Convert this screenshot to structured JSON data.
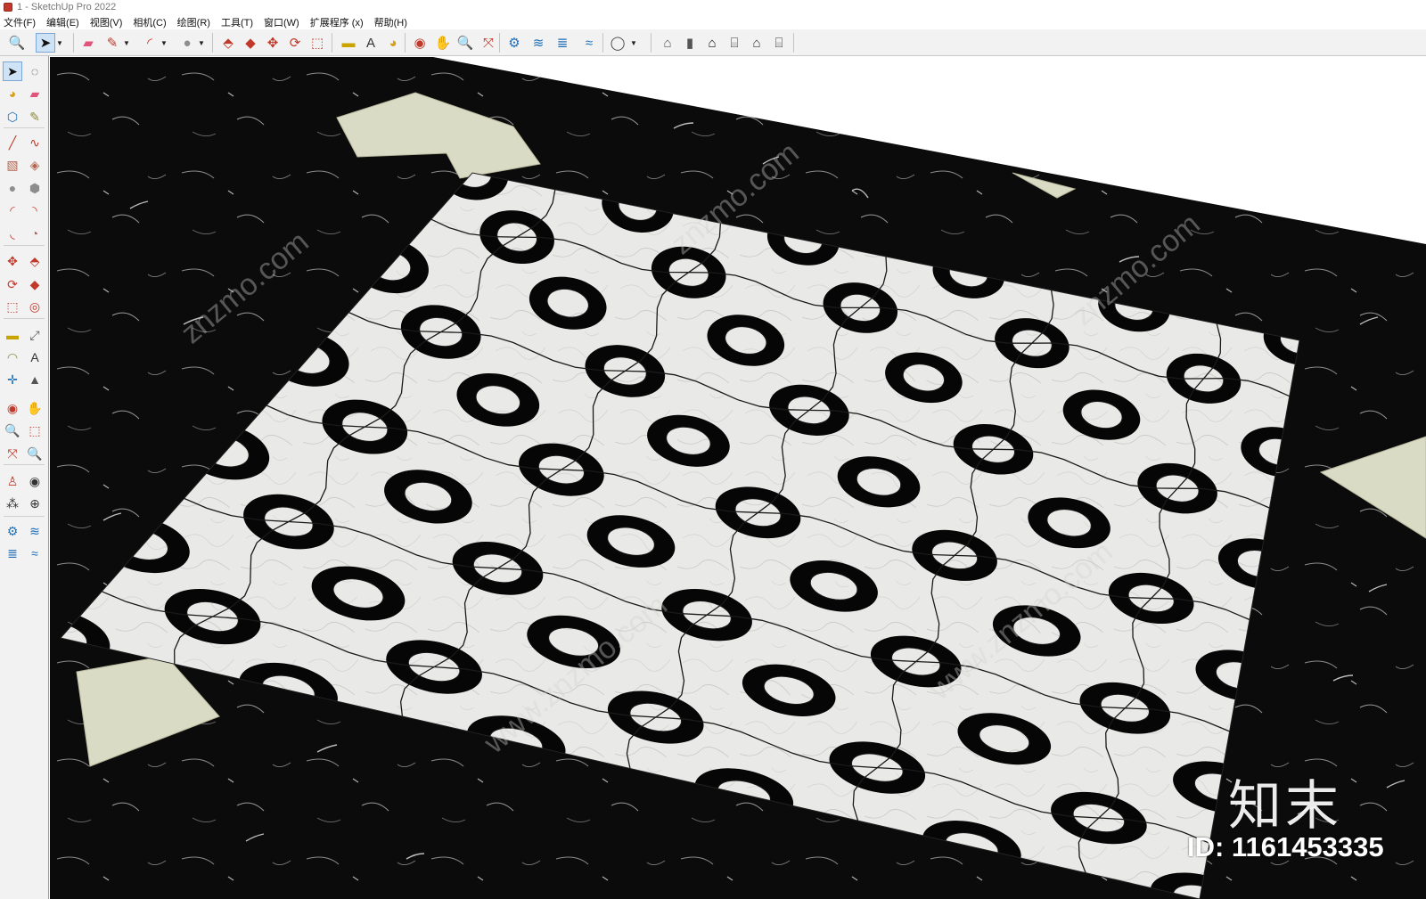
{
  "window": {
    "title": "1 - SketchUp Pro 2022"
  },
  "menu": {
    "items": [
      "文件(F)",
      "编辑(E)",
      "视图(V)",
      "相机(C)",
      "绘图(R)",
      "工具(T)",
      "窗口(W)",
      "扩展程序 (x)",
      "帮助(H)"
    ]
  },
  "toolbar": {
    "tools": [
      {
        "icon": "zoom-icon",
        "glyph": "🔍",
        "color": "#2b2b2b"
      },
      {
        "icon": "select-arrow-icon",
        "glyph": "➤",
        "color": "#111111",
        "active": true
      },
      {
        "icon": "eraser-icon",
        "glyph": "▰",
        "color": "#e2557b"
      },
      {
        "icon": "pencil-line-icon",
        "glyph": "✎",
        "color": "#c0392b"
      },
      {
        "icon": "arc-icon",
        "glyph": "◜",
        "color": "#c0392b"
      },
      {
        "icon": "circle-shape-icon",
        "glyph": "●",
        "color": "#8d8d8d"
      },
      {
        "icon": "push-pull-icon",
        "glyph": "⬘",
        "color": "#c0392b"
      },
      {
        "icon": "follow-me-icon",
        "glyph": "◆",
        "color": "#c0392b"
      },
      {
        "icon": "move-icon",
        "glyph": "✥",
        "color": "#c0392b"
      },
      {
        "icon": "rotate-icon",
        "glyph": "⟳",
        "color": "#c0392b"
      },
      {
        "icon": "scale-icon",
        "glyph": "⬚",
        "color": "#c0392b"
      },
      {
        "icon": "tape-measure-icon",
        "glyph": "▬",
        "color": "#c9a400"
      },
      {
        "icon": "text-label-icon",
        "glyph": "A",
        "color": "#333333"
      },
      {
        "icon": "paint-bucket-icon",
        "glyph": "◕",
        "color": "#d4a017"
      },
      {
        "icon": "orbit-icon",
        "glyph": "◉",
        "color": "#c0392b"
      },
      {
        "icon": "pan-hand-icon",
        "glyph": "✋",
        "color": "#d4a017"
      },
      {
        "icon": "zoom-tool-icon",
        "glyph": "🔍",
        "color": "#1f4e8a"
      },
      {
        "icon": "zoom-extents-icon",
        "glyph": "⤧",
        "color": "#c0392b"
      },
      {
        "icon": "3d-warehouse-icon",
        "glyph": "⚙",
        "color": "#1f6fb8"
      },
      {
        "icon": "extension-warehouse-icon",
        "glyph": "≋",
        "color": "#1f6fb8"
      },
      {
        "icon": "layout-send-icon",
        "glyph": "≣",
        "color": "#1f6fb8"
      },
      {
        "icon": "extension-manager-icon",
        "glyph": "≈",
        "color": "#1f6fb8"
      },
      {
        "icon": "user-account-icon",
        "glyph": "◯",
        "color": "#444444"
      },
      {
        "icon": "iso-view-icon",
        "glyph": "⌂",
        "color": "#555555"
      },
      {
        "icon": "top-view-icon",
        "glyph": "▮",
        "color": "#555555"
      },
      {
        "icon": "front-view-icon",
        "glyph": "⌂",
        "color": "#111111"
      },
      {
        "icon": "right-view-icon",
        "glyph": "⌸",
        "color": "#333333"
      },
      {
        "icon": "back-view-icon",
        "glyph": "⌂",
        "color": "#333333"
      },
      {
        "icon": "left-view-icon",
        "glyph": "⌸",
        "color": "#333333"
      }
    ]
  },
  "palette": {
    "tools": [
      {
        "icon": "select-arrow-icon",
        "glyph": "➤",
        "color": "#111111",
        "active": true
      },
      {
        "icon": "lasso-select-icon",
        "glyph": "◌",
        "color": "#333333"
      },
      {
        "icon": "paint-bucket-icon",
        "glyph": "◕",
        "color": "#d4a017"
      },
      {
        "icon": "eraser-icon",
        "glyph": "▰",
        "color": "#e2557b"
      },
      {
        "icon": "make-component-icon",
        "glyph": "⬡",
        "color": "#1f6fb8"
      },
      {
        "icon": "tag-tool-icon",
        "glyph": "✎",
        "color": "#8a8a3a"
      },
      {
        "icon": "line-icon",
        "glyph": "╱",
        "color": "#c0392b"
      },
      {
        "icon": "freehand-icon",
        "glyph": "∿",
        "color": "#c0392b"
      },
      {
        "icon": "rectangle-icon",
        "glyph": "▧",
        "color": "#b5654f"
      },
      {
        "icon": "rotated-rectangle-icon",
        "glyph": "◈",
        "color": "#b5654f"
      },
      {
        "icon": "circle-icon",
        "glyph": "●",
        "color": "#8d8d8d"
      },
      {
        "icon": "polygon-icon",
        "glyph": "⬢",
        "color": "#8d8d8d"
      },
      {
        "icon": "arc-2pt-icon",
        "glyph": "◜",
        "color": "#c0392b"
      },
      {
        "icon": "arc-3pt-icon",
        "glyph": "◝",
        "color": "#c0392b"
      },
      {
        "icon": "arc-center-icon",
        "glyph": "◟",
        "color": "#c0392b"
      },
      {
        "icon": "pie-icon",
        "glyph": "◔",
        "color": "#b5654f"
      },
      {
        "icon": "move-icon",
        "glyph": "✥",
        "color": "#c0392b"
      },
      {
        "icon": "push-pull-icon",
        "glyph": "⬘",
        "color": "#c0392b"
      },
      {
        "icon": "rotate-icon",
        "glyph": "⟳",
        "color": "#c0392b"
      },
      {
        "icon": "follow-me-icon",
        "glyph": "◆",
        "color": "#c0392b"
      },
      {
        "icon": "scale-icon",
        "glyph": "⬚",
        "color": "#c0392b"
      },
      {
        "icon": "offset-icon",
        "glyph": "◎",
        "color": "#c0392b"
      },
      {
        "icon": "tape-measure-icon",
        "glyph": "▬",
        "color": "#c9a400"
      },
      {
        "icon": "dimension-icon",
        "glyph": "⤢",
        "color": "#555555"
      },
      {
        "icon": "protractor-icon",
        "glyph": "◠",
        "color": "#8a8a3a"
      },
      {
        "icon": "text-label-icon",
        "glyph": "A",
        "color": "#333333"
      },
      {
        "icon": "axes-icon",
        "glyph": "✛",
        "color": "#1f6fb8"
      },
      {
        "icon": "3d-text-icon",
        "glyph": "▲",
        "color": "#555555"
      },
      {
        "icon": "orbit-icon",
        "glyph": "◉",
        "color": "#c0392b"
      },
      {
        "icon": "pan-hand-icon",
        "glyph": "✋",
        "color": "#d4a017"
      },
      {
        "icon": "zoom-icon",
        "glyph": "🔍",
        "color": "#1f4e8a"
      },
      {
        "icon": "zoom-window-icon",
        "glyph": "⬚",
        "color": "#c0392b"
      },
      {
        "icon": "zoom-extents-icon",
        "glyph": "⤧",
        "color": "#c0392b"
      },
      {
        "icon": "previous-view-icon",
        "glyph": "🔍",
        "color": "#1f6fb8"
      },
      {
        "icon": "position-camera-icon",
        "glyph": "♙",
        "color": "#c0392b"
      },
      {
        "icon": "look-around-icon",
        "glyph": "◉",
        "color": "#333333"
      },
      {
        "icon": "walk-icon",
        "glyph": "⁂",
        "color": "#333333"
      },
      {
        "icon": "section-plane-icon",
        "glyph": "⊕",
        "color": "#333333"
      },
      {
        "icon": "3d-warehouse-icon",
        "glyph": "⚙",
        "color": "#1f6fb8"
      },
      {
        "icon": "extension-warehouse-icon",
        "glyph": "≋",
        "color": "#1f6fb8"
      },
      {
        "icon": "layout-send-icon",
        "glyph": "≣",
        "color": "#1f6fb8"
      },
      {
        "icon": "extension-manager-icon",
        "glyph": "≈",
        "color": "#1f6fb8"
      }
    ]
  },
  "scene": {
    "floor_color": "#0b0b0b",
    "vein_color": "#bdbdbd",
    "tile_light_color": "#e9e9e7",
    "tile_dark_color": "#060606",
    "grout_color": "#1a1a1a",
    "pad_color": "#dadbc4",
    "background_color": "#ffffff"
  },
  "stamp": {
    "brand": "知末",
    "id": "ID: 1161453335"
  }
}
